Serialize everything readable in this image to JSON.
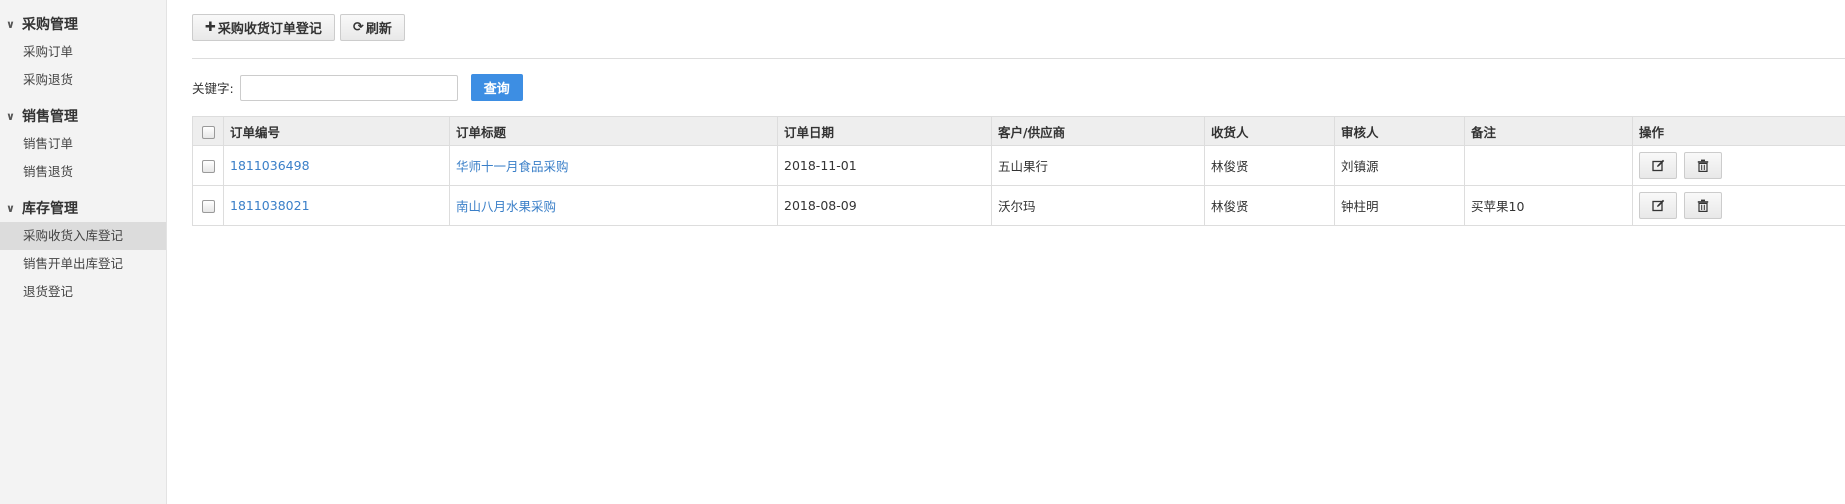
{
  "sidebar": {
    "groups": [
      {
        "label": "采购管理",
        "items": [
          "采购订单",
          "采购退货"
        ]
      },
      {
        "label": "销售管理",
        "items": [
          "销售订单",
          "销售退货"
        ]
      },
      {
        "label": "库存管理",
        "items": [
          "采购收货入库登记",
          "销售开单出库登记",
          "退货登记"
        ]
      }
    ],
    "active_item": "采购收货入库登记"
  },
  "toolbar": {
    "add_label": "采购收货订单登记",
    "add_icon": "plus-icon",
    "refresh_label": "刷新",
    "refresh_icon": "refresh-icon"
  },
  "search": {
    "label": "关键字:",
    "value": "",
    "placeholder": "",
    "button_label": "查询"
  },
  "table": {
    "columns": [
      "订单编号",
      "订单标题",
      "订单日期",
      "客户/供应商",
      "收货人",
      "审核人",
      "备注",
      "操作"
    ],
    "rows": [
      {
        "order_no": "1811036498",
        "title": "华师十一月食品采购",
        "date": "2018-11-01",
        "partner": "五山果行",
        "receiver": "林俊贤",
        "reviewer": "刘镇源",
        "remark": ""
      },
      {
        "order_no": "1811038021",
        "title": "南山八月水果采购",
        "date": "2018-08-09",
        "partner": "沃尔玛",
        "receiver": "林俊贤",
        "reviewer": "钟柱明",
        "remark": "买苹果10"
      }
    ],
    "row_actions": [
      "edit-icon",
      "trash-icon"
    ]
  },
  "colors": {
    "primary_button": "#3d8ee3",
    "link": "#3a7fc8",
    "sidebar_bg": "#f3f3f3",
    "sidebar_active_bg": "#dcdcdc",
    "table_header_bg": "#eeeeee"
  }
}
